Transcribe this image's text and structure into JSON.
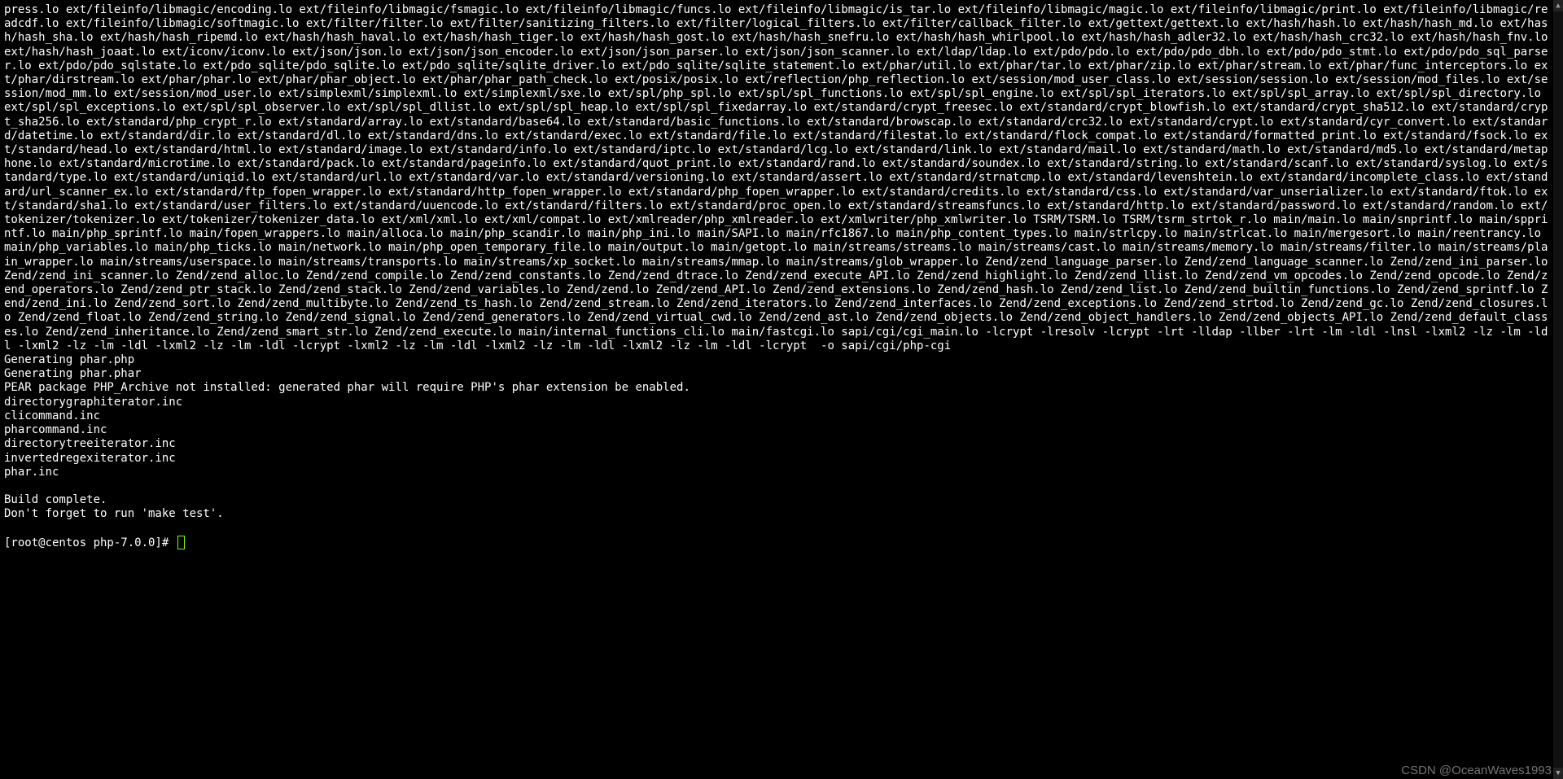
{
  "terminal": {
    "compile_output": "press.lo ext/fileinfo/libmagic/encoding.lo ext/fileinfo/libmagic/fsmagic.lo ext/fileinfo/libmagic/funcs.lo ext/fileinfo/libmagic/is_tar.lo ext/fileinfo/libmagic/magic.lo ext/fileinfo/libmagic/print.lo ext/fileinfo/libmagic/readcdf.lo ext/fileinfo/libmagic/softmagic.lo ext/filter/filter.lo ext/filter/sanitizing_filters.lo ext/filter/logical_filters.lo ext/filter/callback_filter.lo ext/gettext/gettext.lo ext/hash/hash.lo ext/hash/hash_md.lo ext/hash/hash_sha.lo ext/hash/hash_ripemd.lo ext/hash/hash_haval.lo ext/hash/hash_tiger.lo ext/hash/hash_gost.lo ext/hash/hash_snefru.lo ext/hash/hash_whirlpool.lo ext/hash/hash_adler32.lo ext/hash/hash_crc32.lo ext/hash/hash_fnv.lo ext/hash/hash_joaat.lo ext/iconv/iconv.lo ext/json/json.lo ext/json/json_encoder.lo ext/json/json_parser.lo ext/json/json_scanner.lo ext/ldap/ldap.lo ext/pdo/pdo.lo ext/pdo/pdo_dbh.lo ext/pdo/pdo_stmt.lo ext/pdo/pdo_sql_parser.lo ext/pdo/pdo_sqlstate.lo ext/pdo_sqlite/pdo_sqlite.lo ext/pdo_sqlite/sqlite_driver.lo ext/pdo_sqlite/sqlite_statement.lo ext/phar/util.lo ext/phar/tar.lo ext/phar/zip.lo ext/phar/stream.lo ext/phar/func_interceptors.lo ext/phar/dirstream.lo ext/phar/phar.lo ext/phar/phar_object.lo ext/phar/phar_path_check.lo ext/posix/posix.lo ext/reflection/php_reflection.lo ext/session/mod_user_class.lo ext/session/session.lo ext/session/mod_files.lo ext/session/mod_mm.lo ext/session/mod_user.lo ext/simplexml/simplexml.lo ext/simplexml/sxe.lo ext/spl/php_spl.lo ext/spl/spl_functions.lo ext/spl/spl_engine.lo ext/spl/spl_iterators.lo ext/spl/spl_array.lo ext/spl/spl_directory.lo ext/spl/spl_exceptions.lo ext/spl/spl_observer.lo ext/spl/spl_dllist.lo ext/spl/spl_heap.lo ext/spl/spl_fixedarray.lo ext/standard/crypt_freesec.lo ext/standard/crypt_blowfish.lo ext/standard/crypt_sha512.lo ext/standard/crypt_sha256.lo ext/standard/php_crypt_r.lo ext/standard/array.lo ext/standard/base64.lo ext/standard/basic_functions.lo ext/standard/browscap.lo ext/standard/crc32.lo ext/standard/crypt.lo ext/standard/cyr_convert.lo ext/standard/datetime.lo ext/standard/dir.lo ext/standard/dl.lo ext/standard/dns.lo ext/standard/exec.lo ext/standard/file.lo ext/standard/filestat.lo ext/standard/flock_compat.lo ext/standard/formatted_print.lo ext/standard/fsock.lo ext/standard/head.lo ext/standard/html.lo ext/standard/image.lo ext/standard/info.lo ext/standard/iptc.lo ext/standard/lcg.lo ext/standard/link.lo ext/standard/mail.lo ext/standard/math.lo ext/standard/md5.lo ext/standard/metaphone.lo ext/standard/microtime.lo ext/standard/pack.lo ext/standard/pageinfo.lo ext/standard/quot_print.lo ext/standard/rand.lo ext/standard/soundex.lo ext/standard/string.lo ext/standard/scanf.lo ext/standard/syslog.lo ext/standard/type.lo ext/standard/uniqid.lo ext/standard/url.lo ext/standard/var.lo ext/standard/versioning.lo ext/standard/assert.lo ext/standard/strnatcmp.lo ext/standard/levenshtein.lo ext/standard/incomplete_class.lo ext/standard/url_scanner_ex.lo ext/standard/ftp_fopen_wrapper.lo ext/standard/http_fopen_wrapper.lo ext/standard/php_fopen_wrapper.lo ext/standard/credits.lo ext/standard/css.lo ext/standard/var_unserializer.lo ext/standard/ftok.lo ext/standard/sha1.lo ext/standard/user_filters.lo ext/standard/uuencode.lo ext/standard/filters.lo ext/standard/proc_open.lo ext/standard/streamsfuncs.lo ext/standard/http.lo ext/standard/password.lo ext/standard/random.lo ext/tokenizer/tokenizer.lo ext/tokenizer/tokenizer_data.lo ext/xml/xml.lo ext/xml/compat.lo ext/xmlreader/php_xmlreader.lo ext/xmlwriter/php_xmlwriter.lo TSRM/TSRM.lo TSRM/tsrm_strtok_r.lo main/main.lo main/snprintf.lo main/spprintf.lo main/php_sprintf.lo main/fopen_wrappers.lo main/alloca.lo main/php_scandir.lo main/php_ini.lo main/SAPI.lo main/rfc1867.lo main/php_content_types.lo main/strlcpy.lo main/strlcat.lo main/mergesort.lo main/reentrancy.lo main/php_variables.lo main/php_ticks.lo main/network.lo main/php_open_temporary_file.lo main/output.lo main/getopt.lo main/streams/streams.lo main/streams/cast.lo main/streams/memory.lo main/streams/filter.lo main/streams/plain_wrapper.lo main/streams/userspace.lo main/streams/transports.lo main/streams/xp_socket.lo main/streams/mmap.lo main/streams/glob_wrapper.lo Zend/zend_language_parser.lo Zend/zend_language_scanner.lo Zend/zend_ini_parser.lo Zend/zend_ini_scanner.lo Zend/zend_alloc.lo Zend/zend_compile.lo Zend/zend_constants.lo Zend/zend_dtrace.lo Zend/zend_execute_API.lo Zend/zend_highlight.lo Zend/zend_llist.lo Zend/zend_vm_opcodes.lo Zend/zend_opcode.lo Zend/zend_operators.lo Zend/zend_ptr_stack.lo Zend/zend_stack.lo Zend/zend_variables.lo Zend/zend.lo Zend/zend_API.lo Zend/zend_extensions.lo Zend/zend_hash.lo Zend/zend_list.lo Zend/zend_builtin_functions.lo Zend/zend_sprintf.lo Zend/zend_ini.lo Zend/zend_sort.lo Zend/zend_multibyte.lo Zend/zend_ts_hash.lo Zend/zend_stream.lo Zend/zend_iterators.lo Zend/zend_interfaces.lo Zend/zend_exceptions.lo Zend/zend_strtod.lo Zend/zend_gc.lo Zend/zend_closures.lo Zend/zend_float.lo Zend/zend_string.lo Zend/zend_signal.lo Zend/zend_generators.lo Zend/zend_virtual_cwd.lo Zend/zend_ast.lo Zend/zend_objects.lo Zend/zend_object_handlers.lo Zend/zend_objects_API.lo Zend/zend_default_classes.lo Zend/zend_inheritance.lo Zend/zend_smart_str.lo Zend/zend_execute.lo main/internal_functions_cli.lo main/fastcgi.lo sapi/cgi/cgi_main.lo -lcrypt -lresolv -lcrypt -lrt -lldap -llber -lrt -lm -ldl -lnsl -lxml2 -lz -lm -ldl -lxml2 -lz -lm -ldl -lxml2 -lz -lm -ldl -lcrypt -lxml2 -lz -lm -ldl -lxml2 -lz -lm -ldl -lxml2 -lz -lm -ldl -lcrypt  -o sapi/cgi/php-cgi",
    "gen1": "Generating phar.php",
    "gen2": "Generating phar.phar",
    "pear": "PEAR package PHP_Archive not installed: generated phar will require PHP's phar extension be enabled.",
    "inc1": "directorygraphiterator.inc",
    "inc2": "clicommand.inc",
    "inc3": "pharcommand.inc",
    "inc4": "directorytreeiterator.inc",
    "inc5": "invertedregexiterator.inc",
    "inc6": "phar.inc",
    "blank": "",
    "complete": "Build complete.",
    "maketest": "Don't forget to run 'make test'.",
    "prompt": "[root@centos php-7.0.0]# "
  },
  "watermark": "CSDN @OceanWaves1993"
}
